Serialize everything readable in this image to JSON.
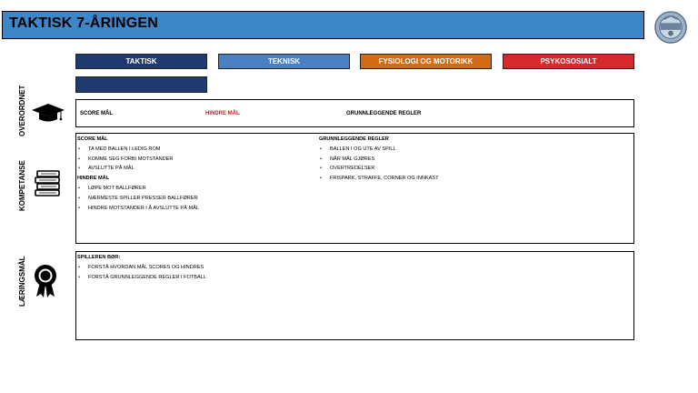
{
  "title": "TAKTISK 7-ÅRINGEN",
  "logo": {
    "icon": "club-crest-icon"
  },
  "tabs": [
    {
      "label": "TAKTISK",
      "color": "#1f3a6e"
    },
    {
      "label": "TEKNISK",
      "color": "#4a7fc1"
    },
    {
      "label": "FYSIOLOGI OG MOTORIKK",
      "color": "#d36b12"
    },
    {
      "label": "PSYKOSOSIALT",
      "color": "#d6282f"
    }
  ],
  "sections": {
    "overordnet": {
      "label": "OVERORDNET",
      "icon": "graduation-cap-icon",
      "items": [
        "SCORE MÅL",
        "HINDRE MÅL",
        "GRUNNLEGGENDE REGLER"
      ]
    },
    "kompetanse": {
      "label": "KOMPETANSE",
      "icon": "books-icon",
      "score_heading": "SCORE MÅL",
      "score_items": [
        "TA MED BALLEN I LEDIG ROM",
        "KOMME SEG FORBI MOTSTANDER",
        "AVSLUTTE PÅ MÅL"
      ],
      "hindre_heading": "HINDRE MÅL",
      "hindre_items": [
        "LØPE MOT BALLFØRER",
        "NÆRMESTE SPILLER PRESSER BALLFØRER",
        "HINDRE MOTSTANDER I Å AVSLUTTE PÅ MÅL"
      ],
      "regler_heading": "GRUNNLEGGENDE REGLER",
      "regler_items": [
        "BALLEN I OG UTE AV SPILL",
        "NÅR MÅL GJØRES",
        "OVERTREDELSER",
        "FRISPARK, STRAFFE, CORNER OG INNKAST"
      ]
    },
    "laeringsmal": {
      "label": "LÆRINGSMÅL",
      "icon": "award-ribbon-icon",
      "heading": "SPILLEREN BØR:",
      "items": [
        "FORSTÅ HVORDAN MÅL SCORES OG HINDRES",
        "FORSTÅ GRUNNLEGGENDE REGLER I FOTBALL"
      ]
    }
  }
}
